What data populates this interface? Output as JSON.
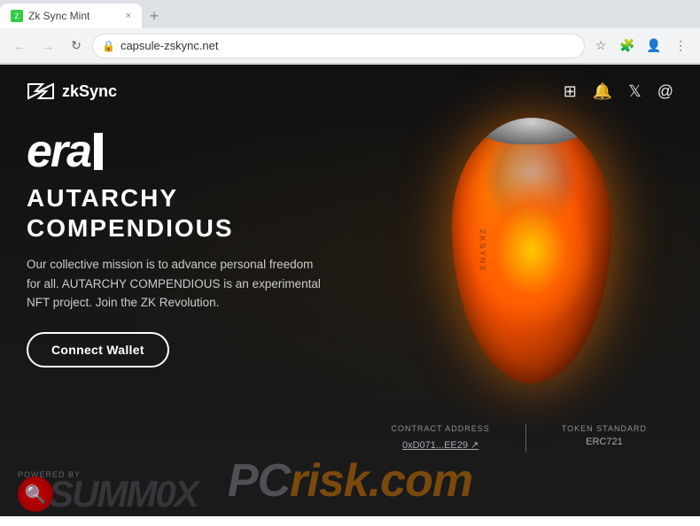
{
  "browser": {
    "tab": {
      "title": "Zk Sync Mint",
      "favicon": "Z",
      "close_label": "×",
      "new_tab_label": "+"
    },
    "nav": {
      "back_label": "←",
      "forward_label": "→",
      "reload_label": "↻",
      "url": "capsule-zskync.net",
      "lock_icon": "🔒",
      "bookmark_icon": "☆",
      "profile_icon": "👤",
      "menu_icon": "⋮",
      "extensions_icon": "🧩"
    }
  },
  "header": {
    "logo_text": "zkSync",
    "social_icons": [
      "discord",
      "bell",
      "twitter",
      "at"
    ]
  },
  "hero": {
    "era_text": "era",
    "title_line1": "AUTARCHY",
    "title_line2": "COMPENDIOUS",
    "description": "Our collective mission is to advance personal freedom for all. AUTARCHY COMPENDIOUS is an experimental NFT project. Join the ZK Revolution.",
    "connect_button": "Connect Wallet"
  },
  "contract": {
    "address_label": "CONTRACT ADDRESS",
    "address_value": "0xD071...EE29 ↗",
    "token_label": "TOKEN STANDARD",
    "token_value": "ERC721"
  },
  "footer": {
    "powered_by": "POWERED BY",
    "brand_text": "SUMM0X"
  },
  "watermark": {
    "prefix": "PC",
    "suffix": "risk.com"
  }
}
